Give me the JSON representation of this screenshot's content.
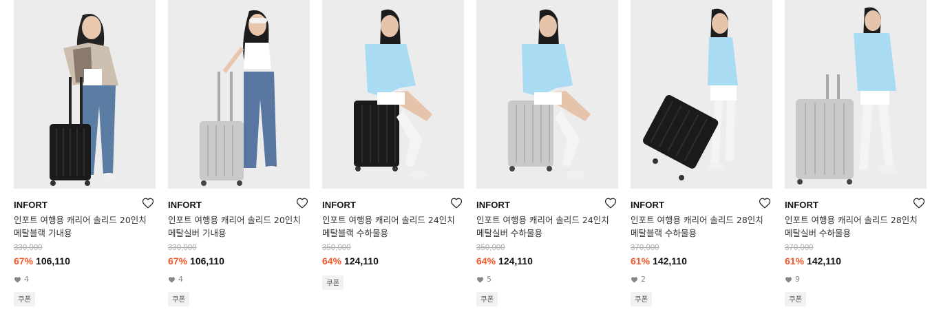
{
  "products": [
    {
      "brand": "INFORT",
      "title": "인포트 여행용 캐리어 솔리드 20인치 메탈블랙 기내용",
      "original_price": "330,000",
      "discount": "67%",
      "price": "106,110",
      "likes": "4",
      "coupon": "쿠폰",
      "suitcase_color": "#1a1a1a",
      "image_subject": "model standing with black carry-on suitcase"
    },
    {
      "brand": "INFORT",
      "title": "인포트 여행용 캐리어 솔리드 20인치 메탈실버 기내용",
      "original_price": "330,000",
      "discount": "67%",
      "price": "106,110",
      "likes": "4",
      "coupon": "쿠폰",
      "suitcase_color": "#c9c9c9",
      "image_subject": "model standing with silver carry-on suitcase"
    },
    {
      "brand": "INFORT",
      "title": "인포트 여행용 캐리어 솔리드 24인치 메탈블랙 수하물용",
      "original_price": "350,000",
      "discount": "64%",
      "price": "124,110",
      "likes": "",
      "coupon": "쿠폰",
      "suitcase_color": "#1a1a1a",
      "image_subject": "model sitting on black suitcase"
    },
    {
      "brand": "INFORT",
      "title": "인포트 여행용 캐리어 솔리드 24인치 메탈실버 수하물용",
      "original_price": "350,000",
      "discount": "64%",
      "price": "124,110",
      "likes": "5",
      "coupon": "쿠폰",
      "suitcase_color": "#c9c9c9",
      "image_subject": "model sitting on silver suitcase"
    },
    {
      "brand": "INFORT",
      "title": "인포트 여행용 캐리어 솔리드 28인치 메탈블랙 수하물용",
      "original_price": "370,000",
      "discount": "61%",
      "price": "142,110",
      "likes": "2",
      "coupon": "쿠폰",
      "suitcase_color": "#1a1a1a",
      "image_subject": "model pulling tilted black suitcase"
    },
    {
      "brand": "INFORT",
      "title": "인포트 여행용 캐리어 솔리드 28인치 메탈실버 수하물용",
      "original_price": "370,000",
      "discount": "61%",
      "price": "142,110",
      "likes": "9",
      "coupon": "쿠폰",
      "suitcase_color": "#c9c9c9",
      "image_subject": "model standing with large silver suitcase"
    }
  ],
  "colors": {
    "discount": "#f1592a",
    "image_bg": "#ececec",
    "coupon_bg": "#f1f1f1"
  },
  "icons": {
    "wishlist": "heart-outline-icon",
    "likes": "heart-filled-icon"
  }
}
